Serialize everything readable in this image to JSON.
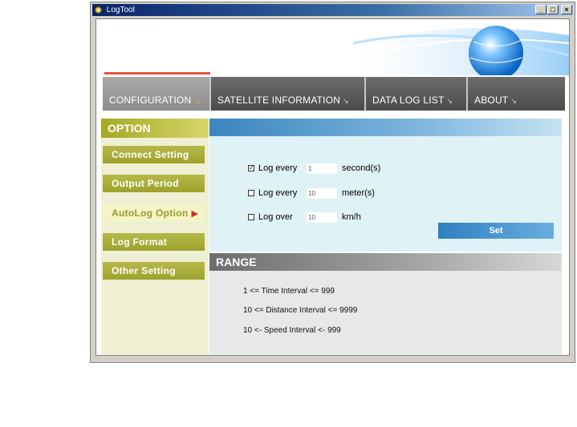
{
  "window": {
    "title": "LogTool",
    "buttons": [
      "_",
      "□",
      "×"
    ]
  },
  "nav": {
    "tabs": [
      {
        "label": "CONFIGURATION",
        "active": true
      },
      {
        "label": "SATELLITE  INFORMATION",
        "active": false
      },
      {
        "label": "DATA  LOG  LIST",
        "active": false
      },
      {
        "label": "ABOUT",
        "active": false
      }
    ],
    "arrow": "↘"
  },
  "sidebar": {
    "title": "OPTION",
    "items": [
      {
        "label": "Connect  Setting"
      },
      {
        "label": "Output  Period"
      },
      {
        "label": "AutoLog  Option",
        "active": true
      },
      {
        "label": "Log  Format"
      },
      {
        "label": "Other  Setting"
      }
    ],
    "active_marker": "▶"
  },
  "option": {
    "rows": [
      {
        "checked": true,
        "label": "Log every",
        "value": "1",
        "unit": "second(s)"
      },
      {
        "checked": false,
        "label": "Log every",
        "value": "10",
        "unit": "meter(s)"
      },
      {
        "checked": false,
        "label": "Log over",
        "value": "10",
        "unit": "km/h"
      }
    ],
    "check_mark": "✓",
    "set_label": "Set"
  },
  "range": {
    "title": "RANGE",
    "lines": [
      "1 <= Time Interval <= 999",
      "10 <= Distance Interval <= 9999",
      "10 <- Speed Interval <- 999"
    ]
  },
  "colors": {
    "nav_bg": "#5a5a5a",
    "sidebar_olive": "#a4a923",
    "option_blue": "#3a86bf",
    "active_arrow": "#d42a1a",
    "accent_red": "#e8503a"
  }
}
